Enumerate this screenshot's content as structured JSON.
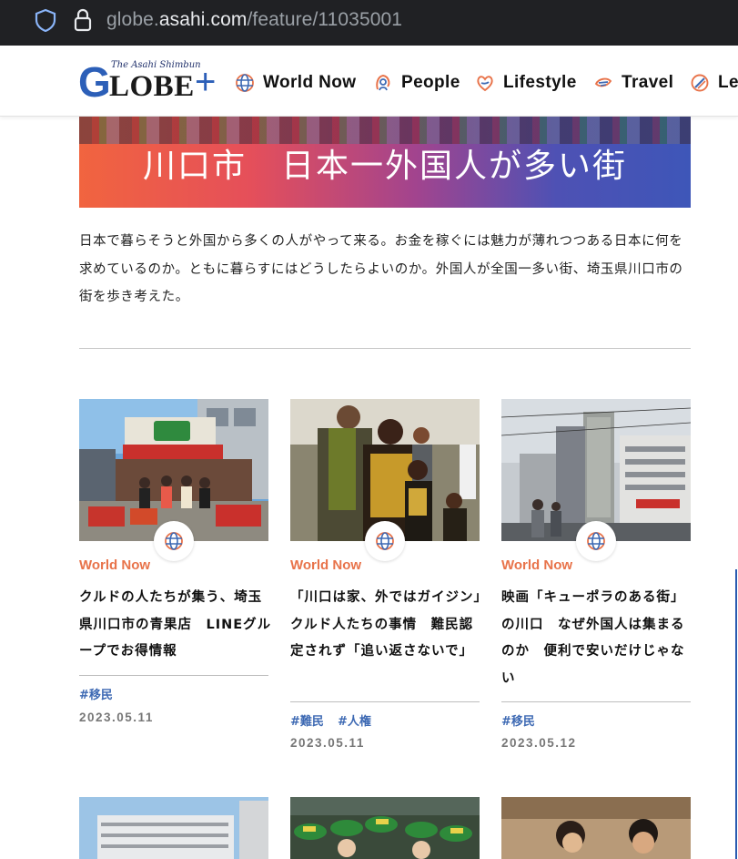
{
  "browser": {
    "url_prefix": "globe.",
    "url_host": "asahi.com",
    "url_path": "/feature/11035001"
  },
  "logo": {
    "subtitle": "The Asahi Shimbun",
    "letter_g": "G",
    "letters": "LOBE",
    "plus": "+"
  },
  "nav": {
    "items": [
      {
        "label": "World Now",
        "icon": "globe-icon"
      },
      {
        "label": "People",
        "icon": "people-icon"
      },
      {
        "label": "Lifestyle",
        "icon": "lifestyle-icon"
      },
      {
        "label": "Travel",
        "icon": "travel-icon"
      },
      {
        "label": "Le",
        "icon": "learning-icon"
      }
    ]
  },
  "hero": {
    "title": "川口市　日本一外国人が多い街"
  },
  "lede": "日本で暮らそうと外国から多くの人がやって来る。お金を稼ぐには魅力が薄れつつある日本に何を求めているのか。ともに暮らすにはどうしたらよいのか。外国人が全国一多い街、埼玉県川口市の街を歩き考えた。",
  "colors": {
    "accent_orange": "#e8734a",
    "tag_blue": "#3d69b3",
    "logo_blue": "#2c5fb8"
  },
  "cards": [
    {
      "category": "World Now",
      "title": "クルドの人たちが集う、埼玉県川口市の青果店　LINEグループでお得情報",
      "tags": [
        "#移民"
      ],
      "date": "2023.05.11",
      "badge_icon": "globe-icon"
    },
    {
      "category": "World Now",
      "title": "「川口は家、外ではガイジン」クルド人たちの事情　難民認定されず「追い返さないで」",
      "tags": [
        "#難民",
        "#人権"
      ],
      "date": "2023.05.11",
      "badge_icon": "globe-icon"
    },
    {
      "category": "World Now",
      "title": "映画「キューポラのある街」の川口　なぜ外国人は集まるのか　便利で安いだけじゃない",
      "tags": [
        "#移民"
      ],
      "date": "2023.05.12",
      "badge_icon": "globe-icon"
    }
  ]
}
